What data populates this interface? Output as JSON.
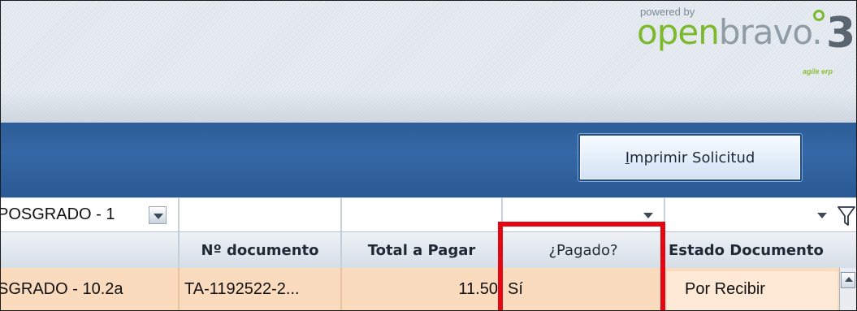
{
  "brand": {
    "powered_by": "powered by",
    "name_open": "open",
    "name_bravo": "bravo.",
    "tagline": "agile erp",
    "version_mark": "3",
    "accent_color": "#7cb92c"
  },
  "toolbar": {
    "print_button_label_underlined": "I",
    "print_button_label_rest": "mprimir Solicitud"
  },
  "filters": {
    "program_value": "POSGRADO - 1",
    "document_value": "",
    "total_value": "",
    "paid_value": "",
    "state_value": "",
    "filter_icon": "funnel-icon"
  },
  "grid": {
    "columns": [
      "",
      "Nº documento",
      "Total a Pagar",
      "¿Pagado?",
      "Estado Documento"
    ],
    "rows": [
      {
        "program": "SGRADO - 10.2a",
        "document": "TA-1192522-2...",
        "total": "11.50",
        "paid": "Sí",
        "state": "Por Recibir"
      }
    ],
    "row_color": "#fadbbd"
  },
  "annotation": {
    "highlight_color": "#e30613"
  }
}
